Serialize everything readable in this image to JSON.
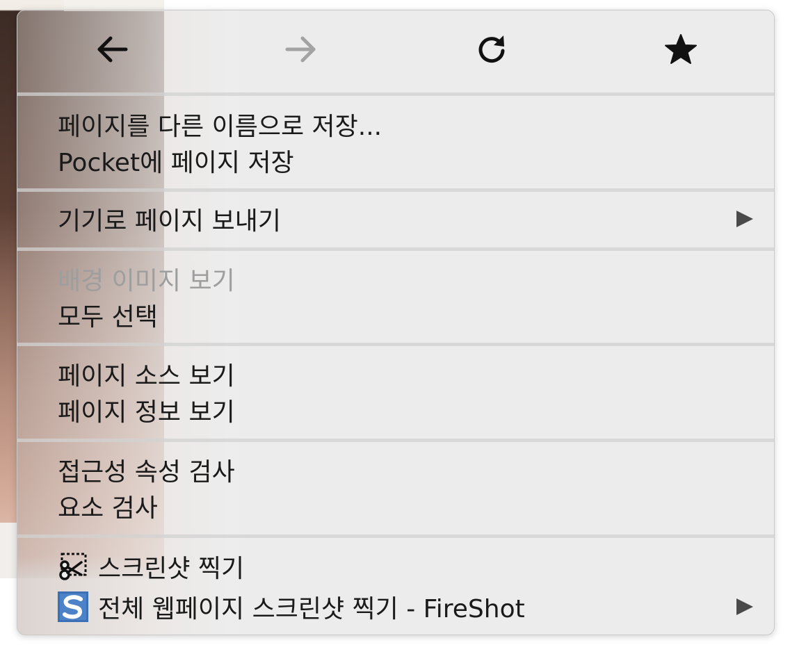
{
  "toolbar": {
    "back_icon": "back-arrow-icon",
    "forward_icon": "forward-arrow-icon",
    "reload_icon": "reload-icon",
    "bookmark_icon": "star-icon",
    "forward_disabled": true
  },
  "menu": {
    "save_page_as": "페이지를 다른 이름으로 저장...",
    "save_to_pocket": "Pocket에 페이지 저장",
    "send_page_to_device": "기기로 페이지 보내기",
    "view_background_image": "배경 이미지 보기",
    "select_all": "모두 선택",
    "view_page_source": "페이지 소스 보기",
    "view_page_info": "페이지 정보 보기",
    "inspect_accessibility": "접근성 속성 검사",
    "inspect_element": "요소 검사",
    "take_screenshot": "스크린샷 찍기",
    "fireshot": "전체 웹페이지 스크린샷 찍기 - FireShot"
  },
  "colors": {
    "text": "#1a1a1a",
    "disabled_text": "#9e9e9e",
    "menu_bg": "#ececec",
    "separator": "#d2d2d2",
    "fireshot_blue": "#3b6fb6"
  }
}
